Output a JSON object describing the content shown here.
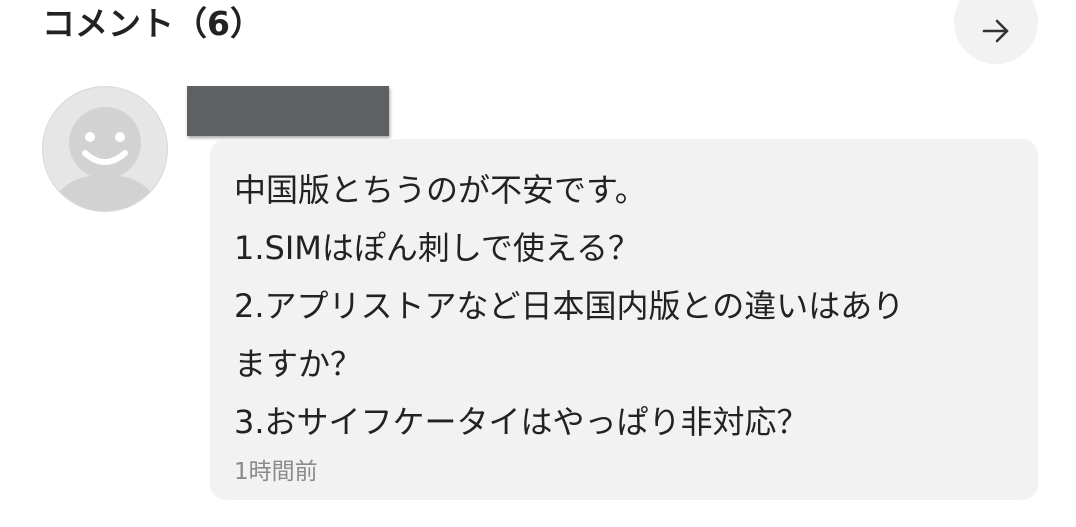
{
  "header": {
    "title": "コメント（6）",
    "next_icon": "arrow-right-icon"
  },
  "comment": {
    "avatar_icon": "smiley-face-avatar-icon",
    "author_redacted": true,
    "lines": [
      "中国版とちうのが不安です。",
      "1.SIMはぽん刺しで使える？",
      "2.アプリストアなど日本国内版との違いはあり",
      "ますか？",
      "3.おサイフケータイはやっぱり非対応？"
    ],
    "timestamp": "1時間前"
  },
  "colors": {
    "bubble": "#f2f2f2",
    "button": "#f2f2f2",
    "redaction": "#5f6063",
    "timestamp": "#8a8a8a",
    "text": "#222222"
  }
}
